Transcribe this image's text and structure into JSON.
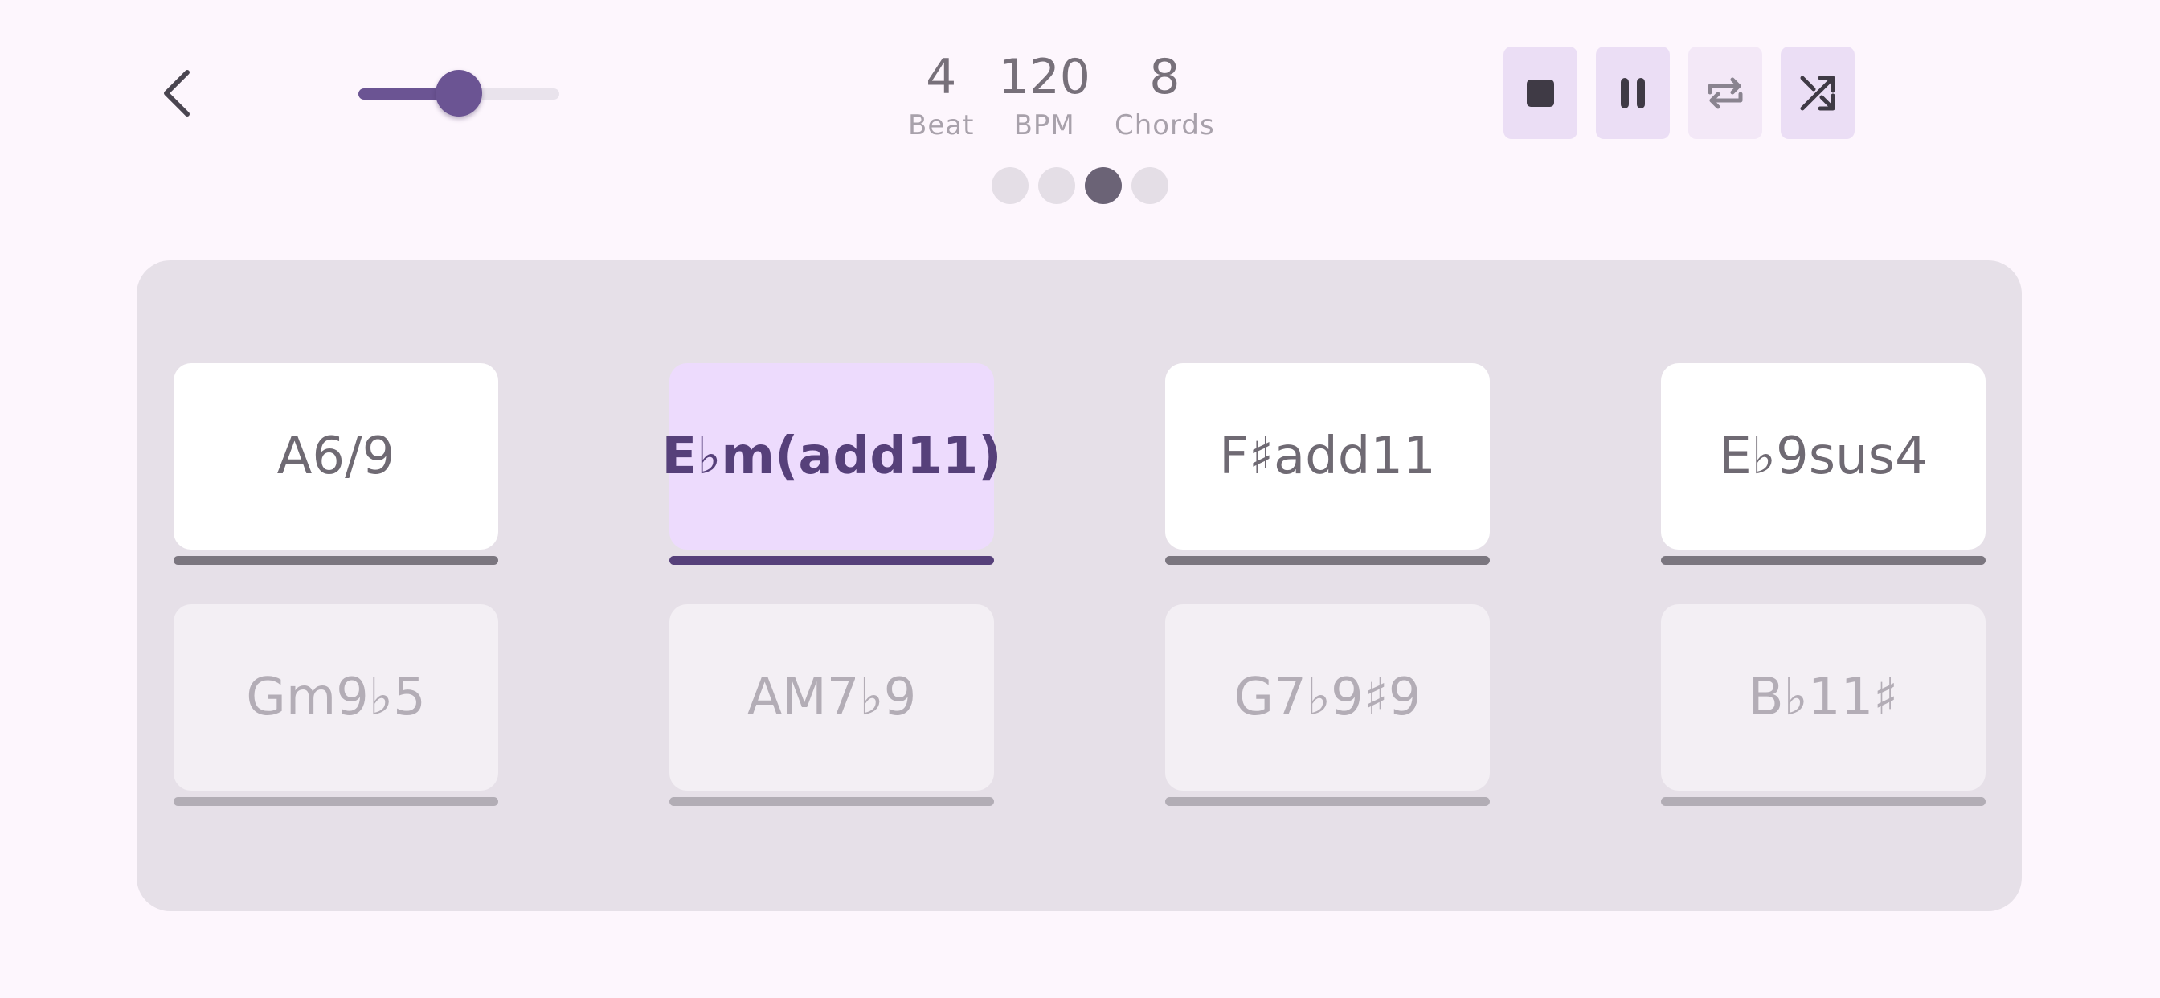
{
  "header": {
    "back_icon": "chevron-left-icon",
    "slider_value_percent": 50,
    "stats": [
      {
        "value": "4",
        "label": "Beat"
      },
      {
        "value": "120",
        "label": "BPM"
      },
      {
        "value": "8",
        "label": "Chords"
      }
    ],
    "pages": {
      "count": 4,
      "active_index": 2
    },
    "controls": [
      {
        "icon": "stop-icon"
      },
      {
        "icon": "pause-icon"
      },
      {
        "icon": "repeat-icon"
      },
      {
        "icon": "shuffle-icon"
      }
    ]
  },
  "chords": {
    "rows": [
      [
        {
          "label": "A6/9",
          "state": "normal"
        },
        {
          "label": "E♭m(add11)",
          "state": "active"
        },
        {
          "label": "F♯add11",
          "state": "normal"
        },
        {
          "label": "E♭9sus4",
          "state": "normal"
        }
      ],
      [
        {
          "label": "Gm9♭5",
          "state": "muted"
        },
        {
          "label": "AM7♭9",
          "state": "muted"
        },
        {
          "label": "G7♭9♯9",
          "state": "muted"
        },
        {
          "label": "B♭11♯",
          "state": "muted"
        }
      ]
    ]
  },
  "colors": {
    "background": "#fdf6fd",
    "panel": "#e6e0e8",
    "accent": "#6b5493",
    "active_card": "#eddbfd",
    "active_text": "#56407a",
    "button_bg": "#ebdef5"
  }
}
